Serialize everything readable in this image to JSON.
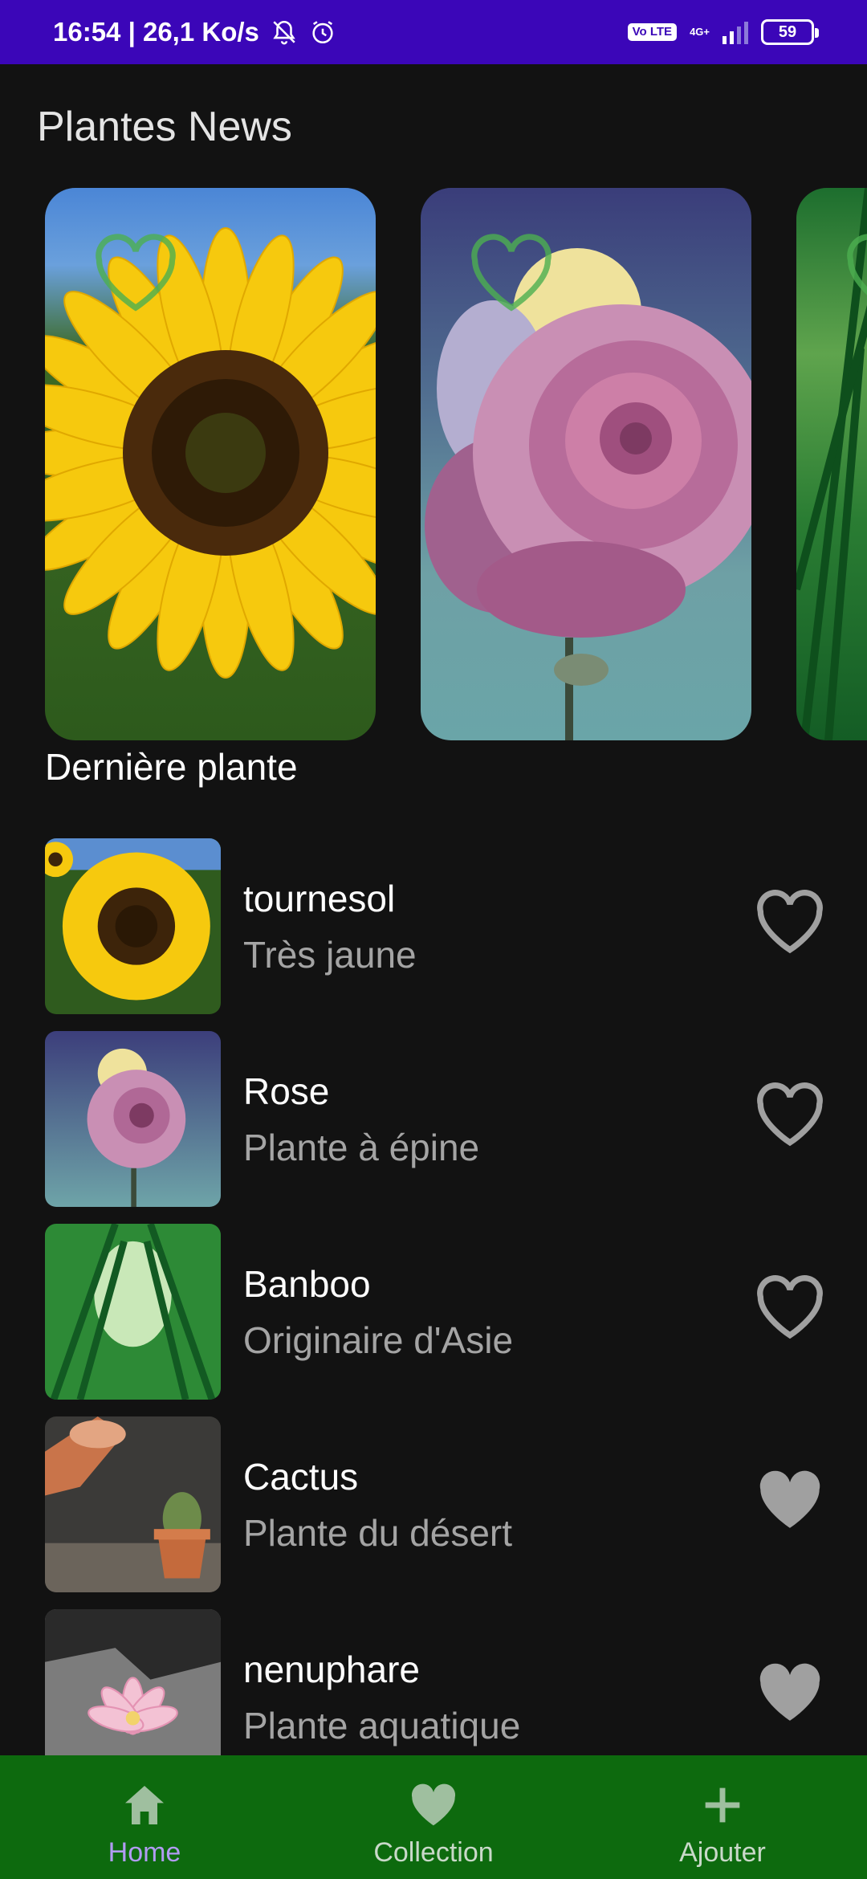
{
  "status_bar": {
    "time_speed": "16:54 | 26,1 Ko/s",
    "volte": "Vo LTE",
    "network_type": "4G+",
    "battery": "59"
  },
  "header": {
    "title": "Plantes News"
  },
  "carousel": {
    "cards": [
      {
        "name": "sunflower-card",
        "favorite": false
      },
      {
        "name": "rose-card",
        "favorite": false
      },
      {
        "name": "bamboo-card",
        "favorite": false
      }
    ]
  },
  "section": {
    "title": "Dernière plante"
  },
  "plants": [
    {
      "name": "tournesol",
      "description": "Très jaune",
      "favorite": false
    },
    {
      "name": "Rose",
      "description": "Plante à épine",
      "favorite": false
    },
    {
      "name": "Banboo",
      "description": "Originaire d'Asie",
      "favorite": false
    },
    {
      "name": "Cactus",
      "description": "Plante du désert",
      "favorite": true
    },
    {
      "name": "nenuphare",
      "description": "Plante aquatique",
      "favorite": true
    }
  ],
  "bottom_nav": {
    "items": [
      {
        "label": "Home",
        "icon": "home-icon",
        "active": true
      },
      {
        "label": "Collection",
        "icon": "heart-icon",
        "active": false
      },
      {
        "label": "Ajouter",
        "icon": "plus-icon",
        "active": false
      }
    ]
  },
  "colors": {
    "status_bar": "#3b06b8",
    "background": "#121212",
    "bottom_nav": "#0d6a0e",
    "active_nav": "#b19cf2",
    "card_heart": "#4caf50",
    "list_heart": "#a0a0a0"
  }
}
